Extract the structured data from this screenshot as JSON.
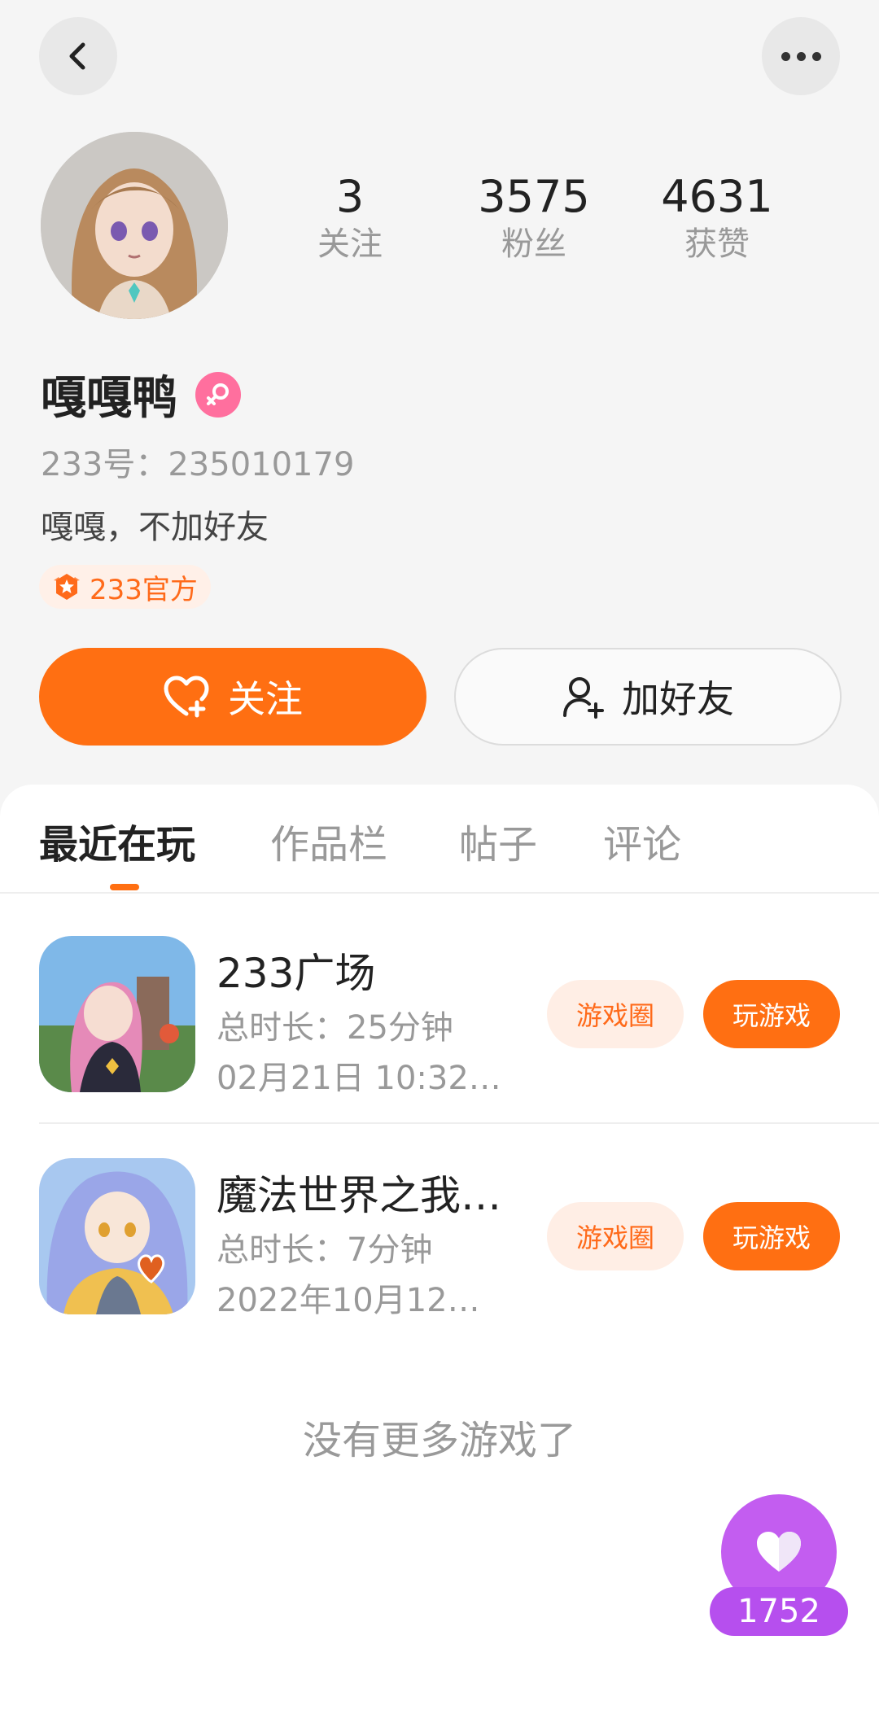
{
  "header": {
    "back_icon": "chevron-left-icon",
    "more_icon": "more-dots-icon"
  },
  "profile": {
    "stats": [
      {
        "value": "3",
        "label": "关注"
      },
      {
        "value": "3575",
        "label": "粉丝"
      },
      {
        "value": "4631",
        "label": "获赞"
      }
    ],
    "name": "嘎嘎鸭",
    "gender_icon": "female-icon",
    "uid_text": "233号：235010179",
    "bio": "嘎嘎，不加好友",
    "badge": "233官方"
  },
  "actions": {
    "follow_label": "关注",
    "add_friend_label": "加好友"
  },
  "tabs": [
    {
      "label": "最近在玩",
      "active": true
    },
    {
      "label": "作品栏",
      "active": false
    },
    {
      "label": "帖子",
      "active": false
    },
    {
      "label": "评论",
      "active": false
    }
  ],
  "games": [
    {
      "title": "233广场",
      "duration": "总时长：25分钟",
      "time": "02月21日 10:32…",
      "circle_label": "游戏圈",
      "play_label": "玩游戏"
    },
    {
      "title": "魔法世界之我…",
      "duration": "总时长：7分钟",
      "time": "2022年10月12…",
      "circle_label": "游戏圈",
      "play_label": "玩游戏"
    }
  ],
  "footer_text": "没有更多游戏了",
  "like_fab": {
    "count": "1752"
  },
  "colors": {
    "accent": "#ff6f12",
    "fab": "#c35df0",
    "badge_text": "#ff6a1a",
    "gender": "#ff6f9e"
  }
}
